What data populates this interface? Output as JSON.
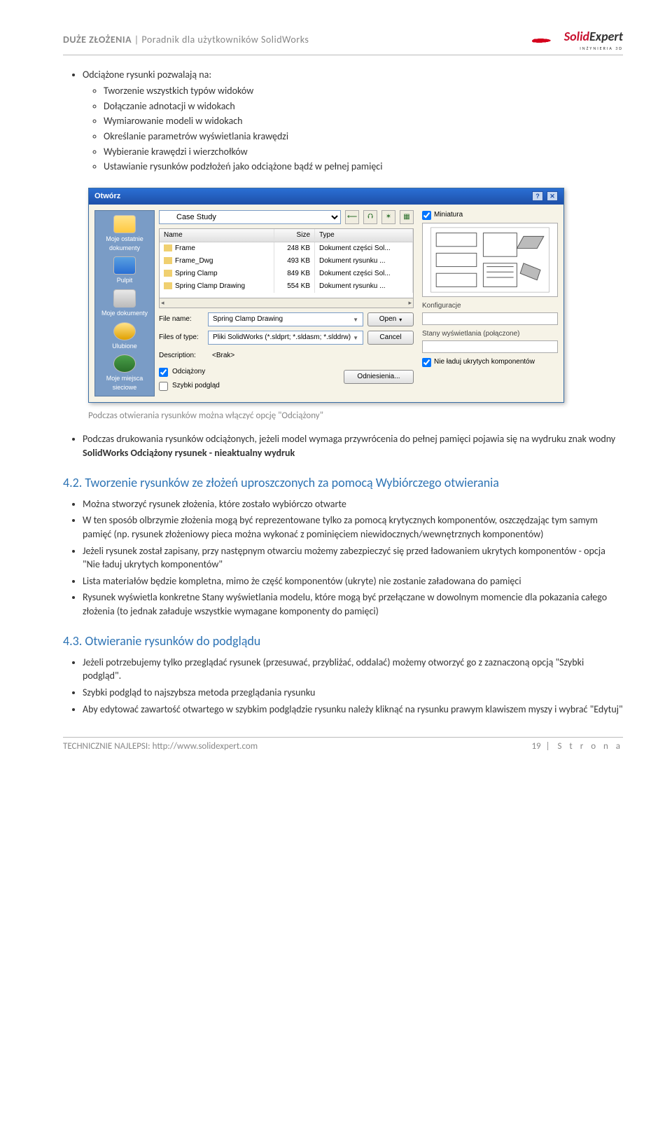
{
  "header": {
    "left_title": "DUŻE ZŁOŻENIA",
    "left_sub": " | Poradnik dla użytkowników SolidWorks",
    "logo_brand1": "Solid",
    "logo_brand2": "Expert",
    "logo_sub": "INŻYNIERIA 3D"
  },
  "section1": {
    "intro": "Odciążone rysunki pozwalają na:",
    "items": [
      "Tworzenie wszystkich typów widoków",
      "Dołączanie adnotacji w widokach",
      "Wymiarowanie modeli w widokach",
      "Określanie parametrów wyświetlania krawędzi",
      "Wybieranie krawędzi i wierzchołków",
      "Ustawianie rysunków podzłożeń jako odciążone bądź w pełnej pamięci"
    ]
  },
  "dialog": {
    "title": "Otwórz",
    "places": [
      "Moje ostatnie dokumenty",
      "Pulpit",
      "Moje dokumenty",
      "Ulubione",
      "Moje miejsca sieciowe"
    ],
    "lookin_label": "",
    "lookin_value": "Case Study",
    "cols": {
      "name": "Name",
      "size": "Size",
      "type": "Type"
    },
    "files": [
      {
        "name": "Frame",
        "size": "248 KB",
        "type": "Dokument części Sol..."
      },
      {
        "name": "Frame_Dwg",
        "size": "493 KB",
        "type": "Dokument rysunku ..."
      },
      {
        "name": "Spring Clamp",
        "size": "849 KB",
        "type": "Dokument części Sol..."
      },
      {
        "name": "Spring Clamp Drawing",
        "size": "554 KB",
        "type": "Dokument rysunku ..."
      }
    ],
    "filename_label": "File name:",
    "filename_value": "Spring Clamp Drawing",
    "filetype_label": "Files of type:",
    "filetype_value": "Pliki SolidWorks (*.sldprt; *.sldasm; *.slddrw)",
    "desc_label": "Description:",
    "desc_value": "<Brak>",
    "open_btn": "Open",
    "cancel_btn": "Cancel",
    "ref_btn": "Odniesienia...",
    "chk_odciazone": "Odciążony",
    "chk_szybki": "Szybki podgląd",
    "right": {
      "miniatura": "Miniatura",
      "konf": "Konfiguracje",
      "stany": "Stany wyświetlania (połączone)",
      "nieladuj": "Nie ładuj ukrytych komponentów"
    }
  },
  "caption1": "Podczas otwierania rysunków można włączyć opcję \"Odciążony\"",
  "afterimg": {
    "bullet_pre": "Podczas drukowania rysunków odciążonych, jeżeli model wymaga przywrócenia do pełnej pamięci pojawia się na wydruku znak wodny ",
    "bold": "SolidWorks Odciążony rysunek - nieaktualny wydruk"
  },
  "sec42": {
    "heading": "4.2. Tworzenie rysunków ze złożeń uproszczonych za pomocą Wybiórczego otwierania",
    "items": [
      "Można stworzyć rysunek złożenia, które zostało wybiórczo otwarte",
      "W ten sposób olbrzymie złożenia mogą być reprezentowane tylko za pomocą krytycznych komponentów, oszczędzając tym samym pamięć (np. rysunek złożeniowy pieca można wykonać z pominięciem niewidocznych/wewnętrznych komponentów)",
      "Jeżeli rysunek został zapisany, przy następnym otwarciu możemy zabezpieczyć się przed ładowaniem ukrytych komponentów - opcja \"Nie ładuj ukrytych komponentów\"",
      "Lista materiałów będzie kompletna, mimo że część komponentów (ukryte) nie zostanie załadowana do pamięci",
      "Rysunek wyświetla konkretne Stany wyświetlania modelu, które mogą być przełączane w dowolnym momencie dla pokazania całego złożenia (to jednak załaduje wszystkie wymagane komponenty do pamięci)"
    ]
  },
  "sec43": {
    "heading": "4.3. Otwieranie rysunków do podglądu",
    "items": [
      "Jeżeli potrzebujemy tylko przeglądać rysunek (przesuwać, przybliżać, oddalać) możemy otworzyć go z zaznaczoną opcją \"Szybki podgląd\".",
      "Szybki podgląd to najszybsza metoda przeglądania rysunku",
      "Aby edytować zawartość otwartego w szybkim podglądzie rysunku należy kliknąć na rysunku prawym klawiszem myszy i wybrać \"Edytuj\""
    ]
  },
  "footer": {
    "left_pre": "TECHNICZNIE NAJLEPSI: ",
    "left_url": "http://www.solidexpert.com",
    "page_num": "19",
    "page_word": " | S t r o n a"
  }
}
